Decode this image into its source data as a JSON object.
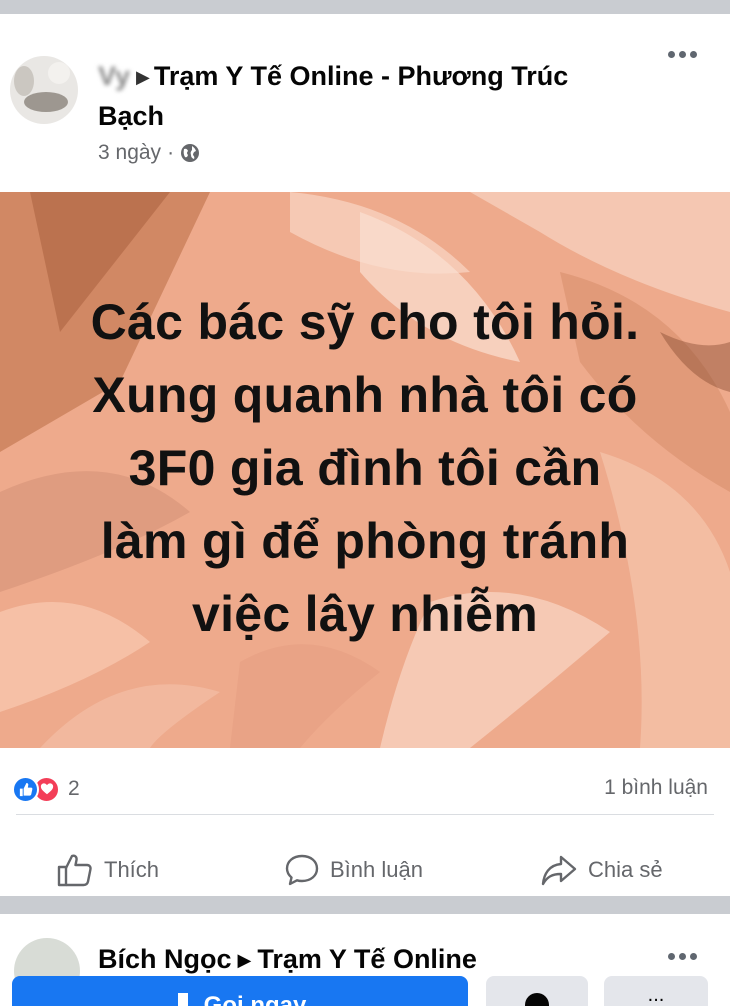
{
  "post": {
    "header": {
      "author_blurred": "Vy",
      "group_name": "Trạm Y Tế Online - Phương Trúc Bạch"
    },
    "timestamp": "3 ngày",
    "separator": "·",
    "privacy_icon": "globe-icon",
    "image_text_lines": [
      "Các bác sỹ cho tôi hỏi.",
      "Xung quanh nhà tôi có",
      "3F0 gia đình tôi cần",
      "làm gì để phòng tránh",
      "việc lây nhiễm"
    ],
    "reaction_count": "2",
    "comment_count": "1 bình luận",
    "actions": {
      "like": "Thích",
      "comment": "Bình luận",
      "share": "Chia sẻ"
    }
  },
  "next_post": {
    "author": "Bích Ngọc",
    "group_name": "Trạm Y Tế Online",
    "call_button": "Gọi ngay",
    "more_button": "..."
  },
  "colors": {
    "brand_blue": "#1877f2",
    "love_red": "#f33e58",
    "image_background": "#eeaa8c",
    "muted_text": "#65676b"
  }
}
